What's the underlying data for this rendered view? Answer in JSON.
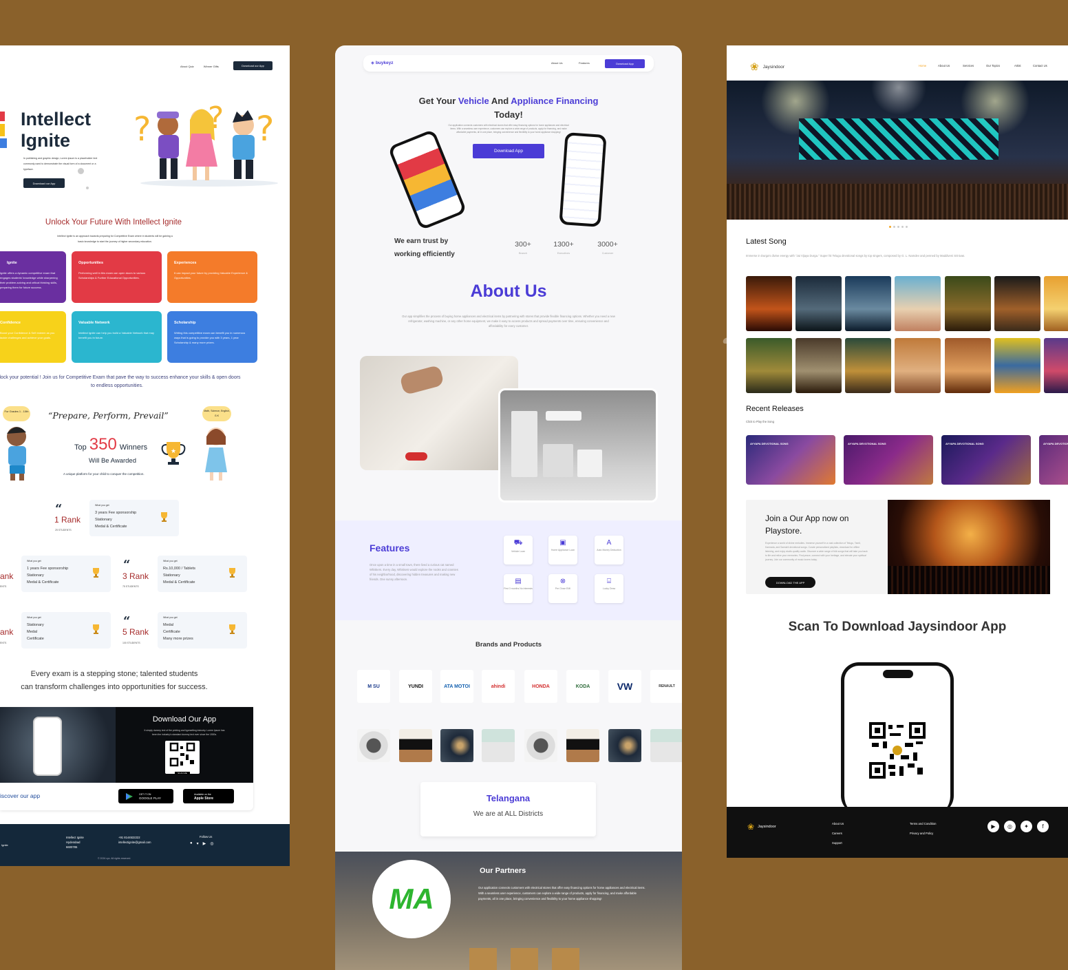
{
  "intellect": {
    "nav": [
      "About Quiz",
      "Winner Gifts"
    ],
    "nav_button": "Download our App",
    "hero_title_1": "Intellect",
    "hero_title_2": "Ignite",
    "hero_text": "In publishing and graphic design, Lorem ipsum is a placeholder text commonly used to demonstrate the visual form of a document or a typeface.",
    "hero_button": "Download our App",
    "unlock_title": "Unlock Your Future With Intellect Ignite",
    "unlock_text": "Intellect Ignite is an approach towards preparing for Competitive Exam where in students will be gaining a basic knowledge to start the journey of higher secondary education.",
    "cards": [
      {
        "title": "Ignite",
        "text": "Ignite offers a dynamic competitive exam that engages students' knowledge while sharpening their problem-solving and critical thinking skills, preparing them for future success.",
        "color": "#6a2fa0"
      },
      {
        "title": "Opportunities",
        "text": "Performing well in this exam can open doors to various Scholarships & Further Educational Opportunities.",
        "color": "#e23a45"
      },
      {
        "title": "Experiences",
        "text": "It can impact your future by providing Valuable Experience & Opportunities.",
        "color": "#f47b2a"
      },
      {
        "title": "Confidence",
        "text": "Boost your Confidence & Self esteem as you tackle challenges and achieve your goals.",
        "color": "#f7d21a"
      },
      {
        "title": "Valuable Network",
        "text": "Intellect Ignite can help you build a Valuable Network that may benefit you in future.",
        "color": "#2bb6cf"
      },
      {
        "title": "Scholarship",
        "text": "Writing this competitive exam can benefit you in numerous ways that is going to provide you with 3 years, 1 year Scholarship & many more prizes.",
        "color": "#3d7ee0"
      }
    ],
    "unlock_potential": "Unlock your potential ! Join us for Competitive Exam that pave the way  to success enhance your skills & open doors to endless opportunities.",
    "bubble_left": "For Grades 1 - 10th",
    "bubble_right": "Math, Science, English, G.K",
    "motto": "“Prepare, Perform, Prevail”",
    "top_prefix": "Top",
    "top_number": "350",
    "top_suffix": "Winners",
    "awarded": "Will Be Awarded",
    "platform": "A unique platform for your child to conquer the competition.",
    "what_you_get": "What you get",
    "rank1": {
      "label": "1 Rank",
      "students": "25 STUDENTS",
      "items": [
        "3 years Fee sponsorship",
        "Stationary",
        "Medal & Certificate"
      ]
    },
    "rank2": {
      "label": "ank",
      "students": "ENTS",
      "items": [
        "1 years Fee sponsorship",
        "Stationary",
        "Medal & Certificate"
      ]
    },
    "rank3": {
      "label": "3 Rank",
      "students": "75 STUDENTS",
      "items": [
        "Rs.10,000 / Tablets",
        "Stationary",
        "Medal & Certificate"
      ]
    },
    "rank4": {
      "label": "ank",
      "students": "ENTS",
      "items": [
        "Stationary",
        "Medal",
        "Certificate"
      ]
    },
    "rank5": {
      "label": "5 Rank",
      "students": "100 STUDENTS",
      "items": [
        "Medal",
        "Certificate",
        "Many more prizes"
      ]
    },
    "stepping_1": "Every exam is a stepping stone; talented students",
    "stepping_2": "can transform challenges into opportunities for success.",
    "download_title": "Download Our App",
    "download_text": "It simply dummy text of the printing and typesetting industry. Lorem Ipsum has been the industry's standard dummy text ever since the 1500s.",
    "scan_me": "SCAN ME",
    "discover": "iscover our app",
    "google_small": "GET IT ON",
    "google_big": "GOOGLE PLAY",
    "apple_small": "Available on the",
    "apple_big": "Apple Store",
    "footer_addr": [
      "Intellect Ignite",
      "Hyderabad",
      "6600785"
    ],
    "footer_phone": "+91 8144532222",
    "footer_email": "intellectignite@gmail.com",
    "footer_follow": "Follow Us",
    "footer_logo": "Ignite",
    "copyright": "© 2024 xyz. All rights reserved."
  },
  "buykeyz": {
    "logo": "buykeyz",
    "nav": [
      "About Us",
      "Features"
    ],
    "nav_button": "Download App",
    "hero_pre": "Get Your ",
    "hero_vehicle": "Vehicle",
    "hero_mid": " And ",
    "hero_appliance": "Appliance Financing",
    "hero_end": "Today!",
    "hero_text": "Our application connects customers with electrical stores that offer easy financing options for home appliances and electrical items. With a seamless user experience, customers can explore a wide range of products, apply for financing, and make affordable payments, all in one place, bringing convenience and flexibility to your home appliance shopping!",
    "hero_button": "Download App",
    "trust_1": "We earn trust by",
    "trust_2": "working efficiently",
    "stats": [
      {
        "value": "300+",
        "label": "Branch"
      },
      {
        "value": "1300+",
        "label": "Executives"
      },
      {
        "value": "3000+",
        "label": "Customer"
      }
    ],
    "about_title": "About Us",
    "about_text": "Our app simplifies the process of buying home appliances and electrical items by partnering with stores that provide flexible financing options. Whether you need a new refrigerator, washing machine, or any other home equipment, we make it easy to access products and spread payments over time, ensuring convenience and affordability for every customer.",
    "features_title": "Features",
    "features_text": "Once upon a time in a small town, there lived a curious cat named Whiskers. Every day, Whiskers would explore the nooks and crannies of his neighborhood, discovering hidden treasures and making new friends. One sunny afternoon.",
    "features": [
      "Vehicle Loan",
      "Home Appliance Loan",
      "Auto Money Deduction",
      "First 3 months No interests",
      "Pre Close EMI",
      "Lucky Draw"
    ],
    "brands_title": "Brands and Products",
    "brands": [
      "M SU",
      "YUNDI",
      "ATA MOTOI",
      "ahindi",
      "HONDA",
      "KODA",
      "VW",
      "RENAULT"
    ],
    "telangana": "Telangana",
    "districts": "We are at ALL Districts",
    "partners_title": "Our Partners",
    "partners_text": "Our application connects customers with electrical stores that offer easy financing options for home appliances and electrical items. With a seamless user experience, customers can explore a wide range of products, apply for financing, and make affordable payments, all in one place, bringing convenience and flexibility to your home appliance shopping!",
    "partner_logo": "MA"
  },
  "jaysindoor": {
    "logo": "Jaysindoor",
    "nav": [
      "Home",
      "About Us",
      "Services",
      "Our Topics",
      "Artist",
      "Contact Us"
    ],
    "latest_title": "Latest Song",
    "latest_text": "Immerse in Durga's divine energy with \"Jai Vijaya Durga.\" Super hit Telugu devotional songs by top singers, composed by G. L. Namdev and penned by Maddiveni Srinivas.",
    "recent_title": "Recent Releases",
    "recent_sub": "Click to Play the Song",
    "release_label": "AYYAPA DEVOTIONAL SONG",
    "join_title_1": "Join a Our App now on",
    "join_title_2": "Playstore.",
    "join_text": "Experience a world of divine melodies. Immerse yourself in a vast collection of Telugu, Tamil, Kannada, and Sanskrit devotional songs. Curate personalized playlists, download for offline listening, and enjoy studio-quality audio. Discover a wide range of folk songs that will take you back to life and relive your memories. Find peace, connect with your heritage, and elevate your spiritual journey. Join our community of music lovers today.",
    "join_button": "DOWNLOAD THE APP",
    "scan_title": "Scan To Download Jaysindoor App",
    "footer_col1": [
      "About Us",
      "Careers",
      "Support"
    ],
    "footer_col2": [
      "Terms and Condition",
      "Privacy and Policy"
    ],
    "social_icons": [
      "youtube-icon",
      "instagram-icon",
      "twitter-icon",
      "facebook-icon"
    ]
  },
  "colors": {
    "background": "#8a612b",
    "buykeyz_primary": "#4b3cd6",
    "intellect_red": "#a52a2a",
    "intellect_dark": "#1c2a3a",
    "jaysindoor_orange": "#f5a623"
  }
}
